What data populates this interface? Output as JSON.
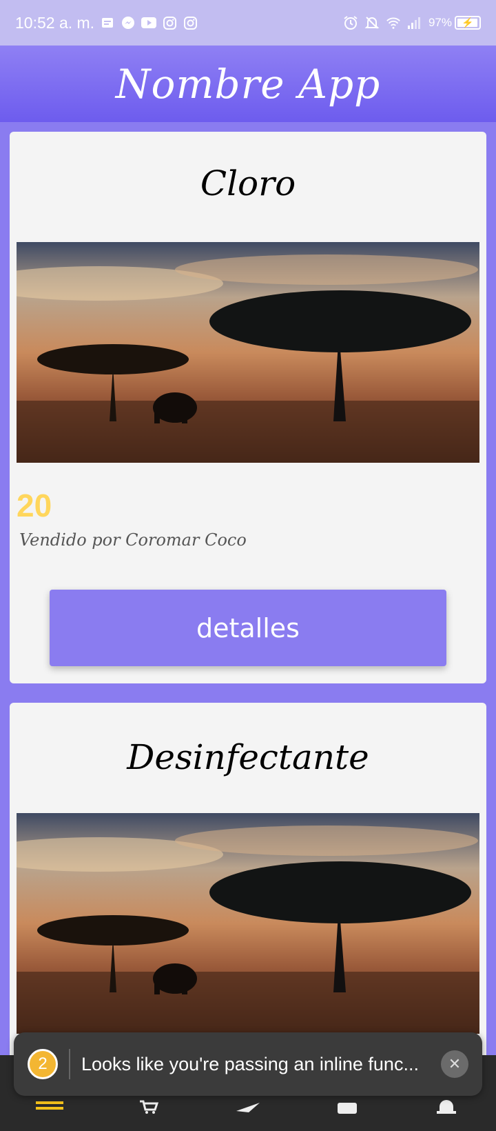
{
  "status_bar": {
    "time": "10:52 a. m.",
    "battery_text": "97%",
    "battery_level": 0.97,
    "left_icons": [
      "notes-icon",
      "messenger-icon",
      "youtube-icon",
      "instagram-icon",
      "instagram-icon"
    ],
    "right_icons": [
      "alarm-icon",
      "silent-icon",
      "wifi-icon",
      "signal-icon"
    ]
  },
  "app_bar": {
    "title": "Nombre App"
  },
  "products": [
    {
      "title": "Cloro",
      "price": "20",
      "seller": "Vendido por Coromar Coco",
      "button_label": "detalles"
    },
    {
      "title": "Desinfectante"
    }
  ],
  "toast": {
    "badge": "2",
    "message": "Looks like you're passing an inline func..."
  },
  "bottom_nav": {
    "items": [
      "list-icon",
      "cart-icon",
      "airplane-icon",
      "card-icon",
      "bell-icon"
    ]
  },
  "colors": {
    "primary": "#8a7cf0",
    "price": "#ffd65c",
    "card_bg": "#f4f4f4"
  }
}
